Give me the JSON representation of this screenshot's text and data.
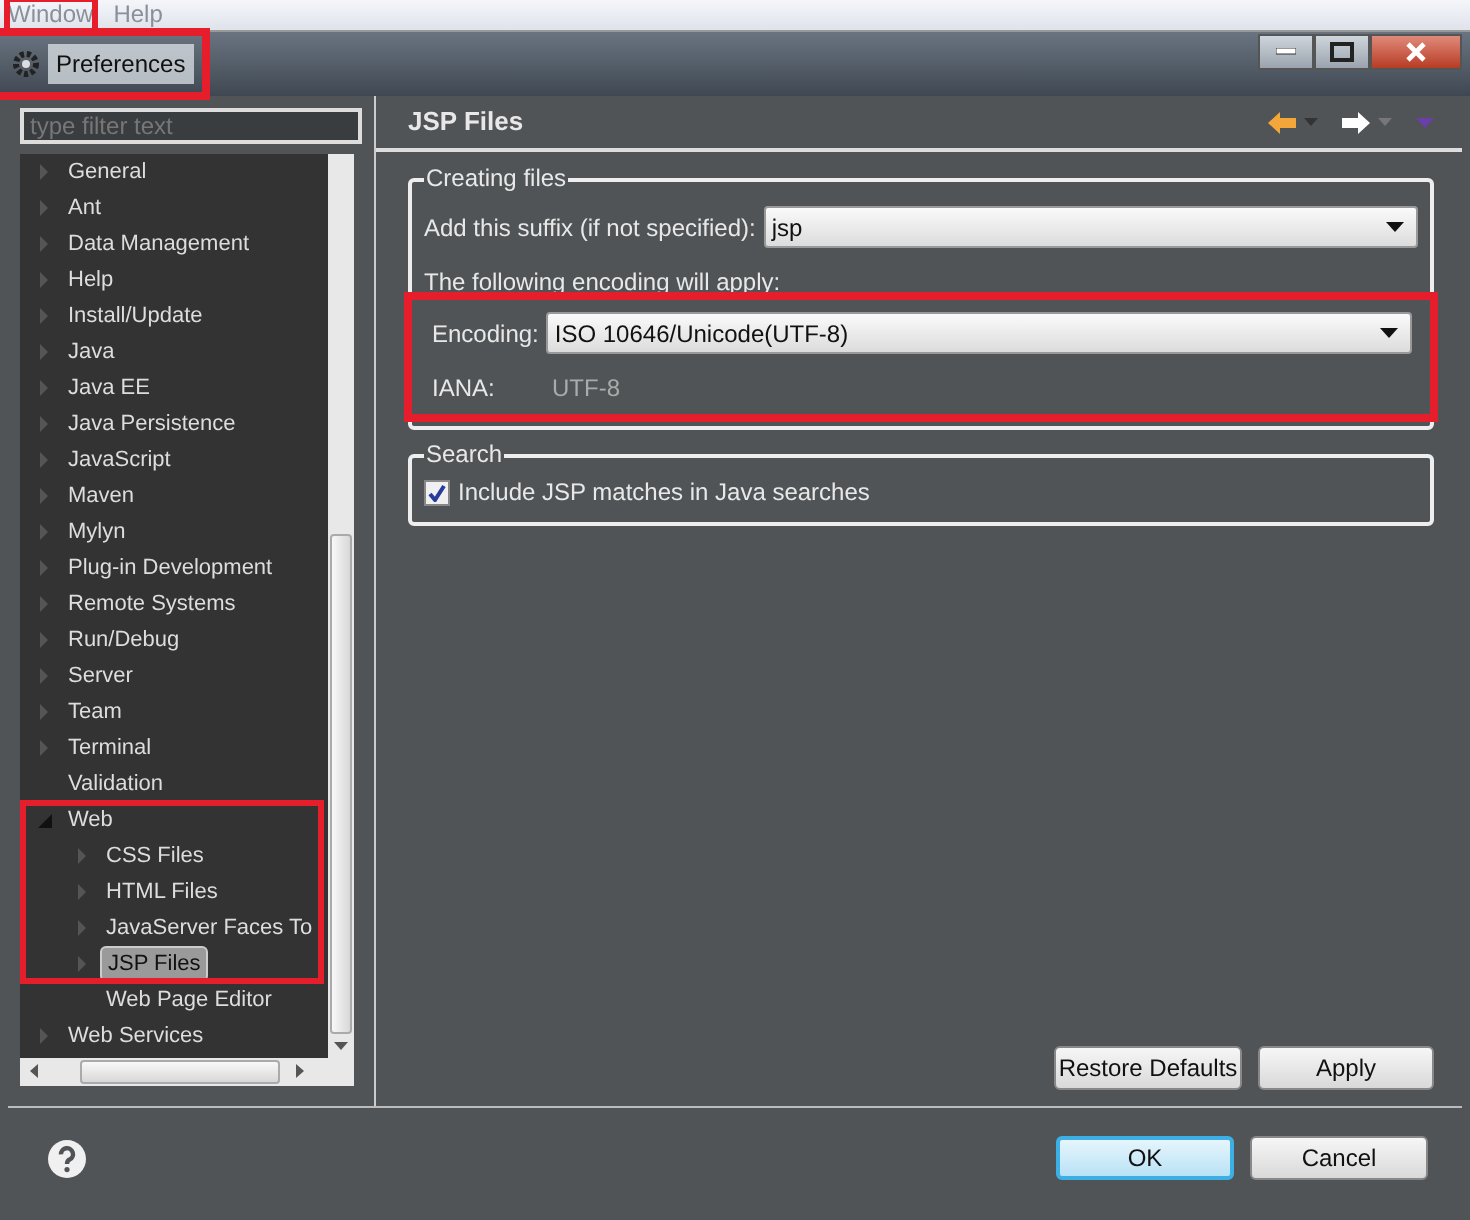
{
  "menubar": [
    {
      "label": "Window",
      "highlighted": true
    },
    {
      "label": "Help",
      "highlighted": false
    }
  ],
  "window": {
    "title": "Preferences",
    "highlighted": true
  },
  "filter": {
    "placeholder": "type filter text"
  },
  "tree": [
    {
      "label": "General",
      "selected": false,
      "expanded": false
    },
    {
      "label": "Ant",
      "selected": false,
      "expanded": false
    },
    {
      "label": "Data Management",
      "selected": false,
      "expanded": false
    },
    {
      "label": "Help",
      "selected": false,
      "expanded": false
    },
    {
      "label": "Install/Update",
      "selected": false,
      "expanded": false
    },
    {
      "label": "Java",
      "selected": false,
      "expanded": false
    },
    {
      "label": "Java EE",
      "selected": false,
      "expanded": false
    },
    {
      "label": "Java Persistence",
      "selected": false,
      "expanded": false
    },
    {
      "label": "JavaScript",
      "selected": false,
      "expanded": false
    },
    {
      "label": "Maven",
      "selected": false,
      "expanded": false
    },
    {
      "label": "Mylyn",
      "selected": false,
      "expanded": false
    },
    {
      "label": "Plug-in Development",
      "selected": false,
      "expanded": false
    },
    {
      "label": "Remote Systems",
      "selected": false,
      "expanded": false
    },
    {
      "label": "Run/Debug",
      "selected": false,
      "expanded": false
    },
    {
      "label": "Server",
      "selected": false,
      "expanded": false
    },
    {
      "label": "Team",
      "selected": false,
      "expanded": false
    },
    {
      "label": "Terminal",
      "selected": false,
      "expanded": false
    },
    {
      "label": "Validation",
      "selected": false
    },
    {
      "label": "Web",
      "selected": false,
      "expanded": true,
      "highlighted": true,
      "children": [
        {
          "label": "CSS Files",
          "selected": false,
          "expanded": false,
          "highlighted": true
        },
        {
          "label": "HTML Files",
          "selected": false,
          "expanded": false,
          "highlighted": true
        },
        {
          "label": "JavaServer Faces To",
          "selected": false,
          "expanded": false,
          "highlighted": true
        },
        {
          "label": "JSP Files",
          "selected": true,
          "expanded": false,
          "highlighted": true
        },
        {
          "label": "Web Page Editor",
          "selected": false,
          "highlighted": false
        }
      ]
    },
    {
      "label": "Web Services",
      "selected": false,
      "expanded": false
    }
  ],
  "page": {
    "title": "JSP Files"
  },
  "creating_files": {
    "legend": "Creating files",
    "suffix_label": "Add this suffix (if not specified):",
    "suffix_value": "jsp",
    "encoding_note": "The following encoding will apply:",
    "encoding_label": "Encoding:",
    "encoding_value": "ISO 10646/Unicode(UTF-8)",
    "iana_label": "IANA:",
    "iana_value": "UTF-8",
    "highlighted": true
  },
  "search": {
    "legend": "Search",
    "option": {
      "label": "Include JSP matches in Java searches",
      "checked": true
    }
  },
  "page_buttons": [
    "Restore Defaults",
    "Apply"
  ],
  "dialog_buttons": [
    {
      "label": "OK",
      "default": true
    },
    {
      "label": "Cancel",
      "default": false
    }
  ]
}
